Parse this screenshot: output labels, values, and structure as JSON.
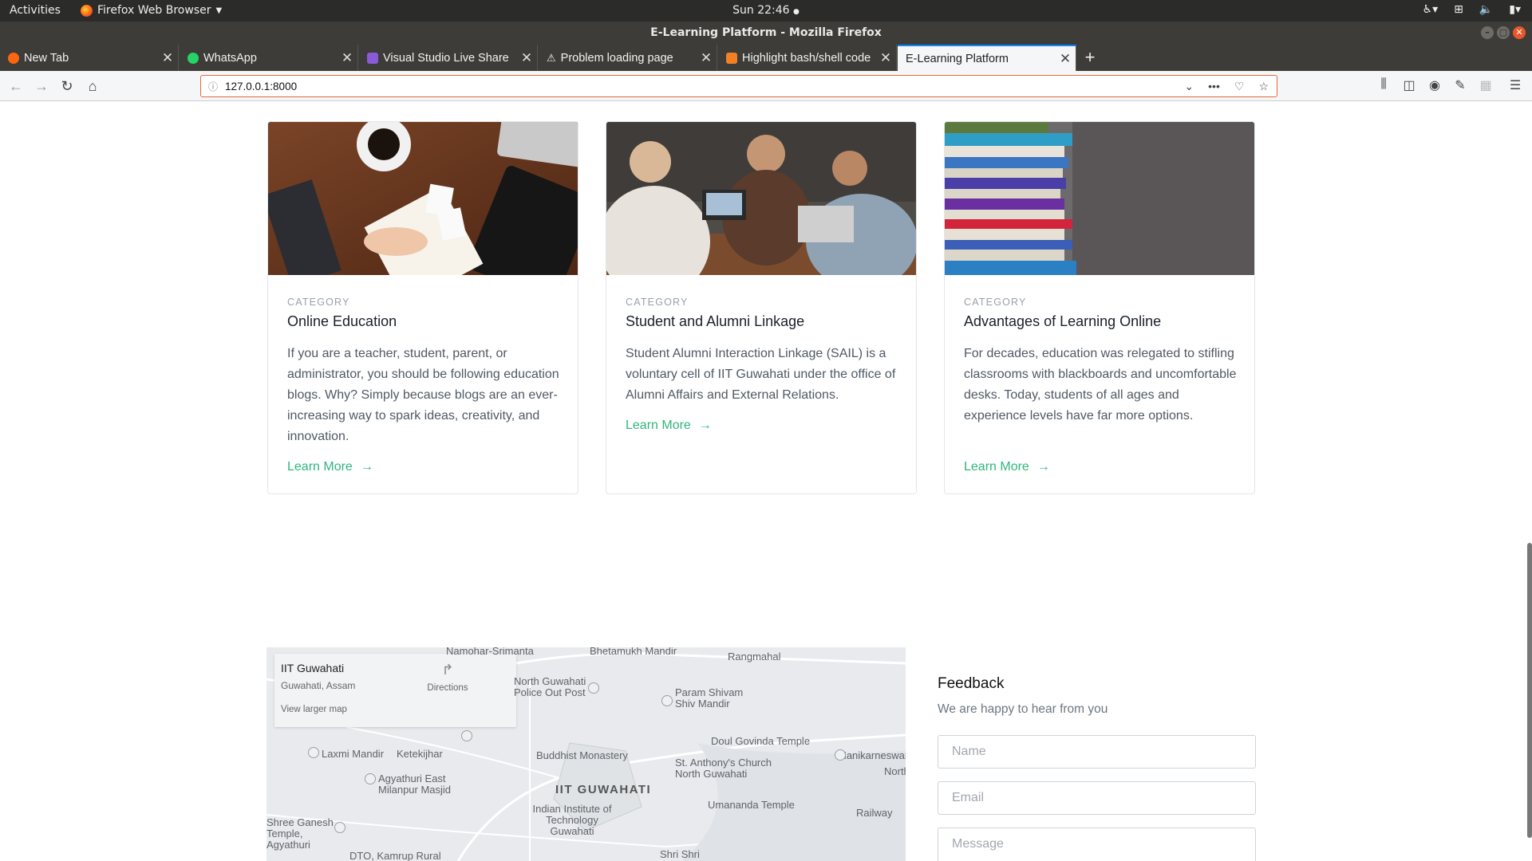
{
  "system": {
    "activities": "Activities",
    "app_menu": "Firefox Web Browser",
    "clock": "Sun 22:46"
  },
  "window": {
    "title": "E-Learning Platform - Mozilla Firefox"
  },
  "tabs": [
    {
      "label": "New Tab",
      "favicon_color": "#ff6611"
    },
    {
      "label": "WhatsApp",
      "favicon_color": "#25d366"
    },
    {
      "label": "Visual Studio Live Share",
      "favicon_color": "#8a5bd6"
    },
    {
      "label": "Problem loading page",
      "favicon_color": "#dddddd"
    },
    {
      "label": "Highlight bash/shell code",
      "favicon_color": "#f48024"
    },
    {
      "label": "E-Learning Platform",
      "favicon_color": "#ffffff"
    }
  ],
  "navbar": {
    "url": "127.0.0.1:8000"
  },
  "cards": [
    {
      "category": "CATEGORY",
      "title": "Online Education",
      "body": "If you are a teacher, student, parent, or administrator, you should be following education blogs. Why? Simply because blogs are an ever-increasing way to spark ideas, creativity, and innovation.",
      "link": "Learn More"
    },
    {
      "category": "CATEGORY",
      "title": "Student and Alumni Linkage",
      "body": "Student Alumni Interaction Linkage (SAIL) is a voluntary cell of IIT Guwahati under the office of Alumni Affairs and External Relations.",
      "link": "Learn More"
    },
    {
      "category": "CATEGORY",
      "title": "Advantages of Learning Online",
      "body": "For decades, education was relegated to stifling classrooms with blackboards and uncomfortable desks. Today, students of all ages and experience levels have far more options.",
      "link": "Learn More"
    }
  ],
  "map": {
    "place_name": "IIT Guwahati",
    "place_address": "Guwahati, Assam",
    "directions": "Directions",
    "larger_map": "View larger map",
    "labels": [
      "Namohar-Srimanta",
      "Bhetamukh Mandir",
      "Rangmahal",
      "North Guwahati Police Out Post",
      "Param Shivam Shiv Mandir",
      "Laxmi Mandir",
      "Ketekijhar",
      "Buddhist Monastery",
      "Doul Govinda Temple",
      "Manikarneswar",
      "St. Anthony's Church North Guwahati",
      "Agyathuri East Milanpur Masjid",
      "IIT GUWAHATI",
      "Indian Institute of Technology Guwahati",
      "Umananda Temple",
      "Railway",
      "Shree Ganesh Temple, Agyathuri",
      "Shri Shri",
      "DTO, Kamrup Rural",
      "North"
    ]
  },
  "feedback": {
    "heading": "Feedback",
    "subheading": "We are happy to hear from you",
    "name_placeholder": "Name",
    "email_placeholder": "Email",
    "message_placeholder": "Message"
  }
}
